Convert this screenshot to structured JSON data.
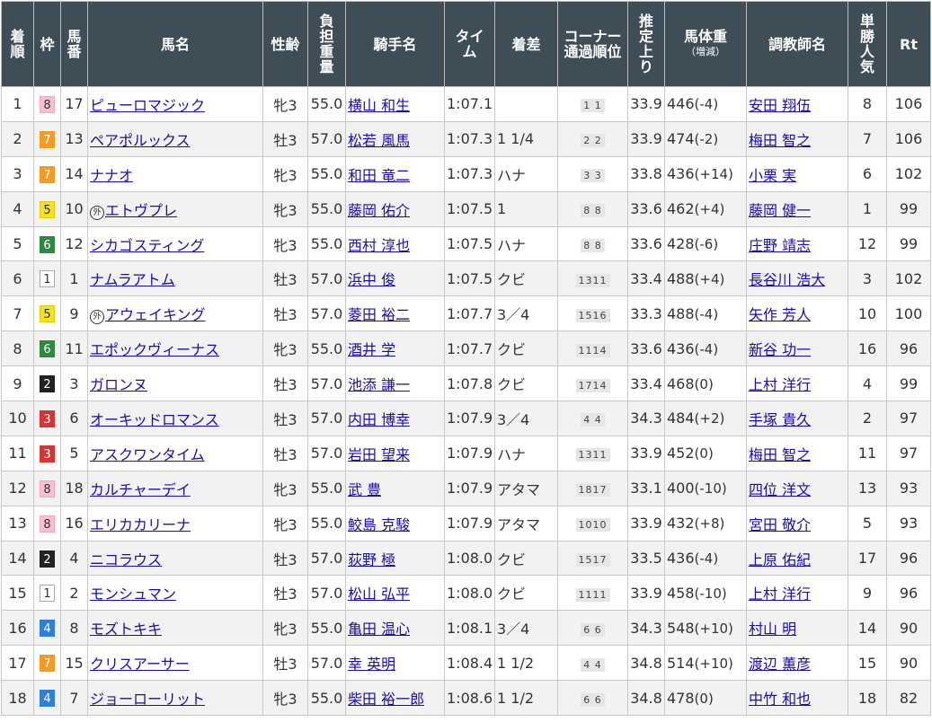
{
  "headers": {
    "rank": [
      "着",
      "順"
    ],
    "waku": [
      "枠"
    ],
    "umaban": [
      "馬",
      "番"
    ],
    "horse": "馬名",
    "sexage": "性齢",
    "weight": [
      "負",
      "担",
      "重",
      "量"
    ],
    "jockey": "騎手名",
    "time": [
      "タイ",
      "ム"
    ],
    "margin": "着差",
    "corner": [
      "コーナー",
      "通過順位"
    ],
    "last3f": [
      "推",
      "定",
      "上",
      "り"
    ],
    "body_weight": "馬体重",
    "body_weight_sub": "（増減）",
    "trainer": "調教師名",
    "popularity": [
      "単",
      "勝",
      "人",
      "気"
    ],
    "rating": "Rt"
  },
  "rows": [
    {
      "rank": "1",
      "waku": "8",
      "umaban": "17",
      "mark": "",
      "horse": "ピューロマジック",
      "sexage": "牝3",
      "weight": "55.0",
      "jockey": "横山 和生",
      "time": "1:07.1",
      "margin": "",
      "corner": "1 1",
      "last3f": "33.9",
      "bw": "446",
      "bwd": "(-4)",
      "trainer": "安田 翔伍",
      "pop": "8",
      "rt": "106"
    },
    {
      "rank": "2",
      "waku": "7",
      "umaban": "13",
      "mark": "",
      "horse": "ペアポルックス",
      "sexage": "牡3",
      "weight": "57.0",
      "jockey": "松若 風馬",
      "time": "1:07.3",
      "margin": "1 1/4",
      "corner": "2 2",
      "last3f": "33.9",
      "bw": "474",
      "bwd": "(-2)",
      "trainer": "梅田 智之",
      "pop": "7",
      "rt": "106"
    },
    {
      "rank": "3",
      "waku": "7",
      "umaban": "14",
      "mark": "",
      "horse": "ナナオ",
      "sexage": "牝3",
      "weight": "55.0",
      "jockey": "和田 竜二",
      "time": "1:07.3",
      "margin": "ハナ",
      "corner": "3 3",
      "last3f": "33.8",
      "bw": "436",
      "bwd": "(+14)",
      "trainer": "小栗 実",
      "pop": "6",
      "rt": "102"
    },
    {
      "rank": "4",
      "waku": "5",
      "umaban": "10",
      "mark": "外",
      "horse": "エトヴプレ",
      "sexage": "牝3",
      "weight": "55.0",
      "jockey": "藤岡 佑介",
      "time": "1:07.5",
      "margin": "1",
      "corner": "8 8",
      "last3f": "33.6",
      "bw": "462",
      "bwd": "(+4)",
      "trainer": "藤岡 健一",
      "pop": "1",
      "rt": "99"
    },
    {
      "rank": "5",
      "waku": "6",
      "umaban": "12",
      "mark": "",
      "horse": "シカゴスティング",
      "sexage": "牝3",
      "weight": "55.0",
      "jockey": "西村 淳也",
      "time": "1:07.5",
      "margin": "ハナ",
      "corner": "8 8",
      "last3f": "33.6",
      "bw": "428",
      "bwd": "(-6)",
      "trainer": "庄野 靖志",
      "pop": "12",
      "rt": "99"
    },
    {
      "rank": "6",
      "waku": "1",
      "umaban": "1",
      "mark": "",
      "horse": "ナムラアトム",
      "sexage": "牡3",
      "weight": "57.0",
      "jockey": "浜中 俊",
      "time": "1:07.5",
      "margin": "クビ",
      "corner": "1311",
      "last3f": "33.4",
      "bw": "488",
      "bwd": "(+4)",
      "trainer": "長谷川 浩大",
      "pop": "3",
      "rt": "102"
    },
    {
      "rank": "7",
      "waku": "5",
      "umaban": "9",
      "mark": "外",
      "horse": "アウェイキング",
      "sexage": "牡3",
      "weight": "57.0",
      "jockey": "菱田 裕二",
      "time": "1:07.7",
      "margin": "3／4",
      "corner": "1516",
      "last3f": "33.3",
      "bw": "488",
      "bwd": "(-4)",
      "trainer": "矢作 芳人",
      "pop": "10",
      "rt": "100"
    },
    {
      "rank": "8",
      "waku": "6",
      "umaban": "11",
      "mark": "",
      "horse": "エポックヴィーナス",
      "sexage": "牝3",
      "weight": "55.0",
      "jockey": "酒井 学",
      "time": "1:07.7",
      "margin": "クビ",
      "corner": "1114",
      "last3f": "33.6",
      "bw": "436",
      "bwd": "(-4)",
      "trainer": "新谷 功一",
      "pop": "16",
      "rt": "96"
    },
    {
      "rank": "9",
      "waku": "2",
      "umaban": "3",
      "mark": "",
      "horse": "ガロンヌ",
      "sexage": "牡3",
      "weight": "57.0",
      "jockey": "池添 謙一",
      "time": "1:07.8",
      "margin": "クビ",
      "corner": "1714",
      "last3f": "33.4",
      "bw": "468",
      "bwd": "(0)",
      "trainer": "上村 洋行",
      "pop": "4",
      "rt": "99"
    },
    {
      "rank": "10",
      "waku": "3",
      "umaban": "6",
      "mark": "",
      "horse": "オーキッドロマンス",
      "sexage": "牡3",
      "weight": "57.0",
      "jockey": "内田 博幸",
      "time": "1:07.9",
      "margin": "3／4",
      "corner": "4 4",
      "last3f": "34.3",
      "bw": "484",
      "bwd": "(+2)",
      "trainer": "手塚 貴久",
      "pop": "2",
      "rt": "97"
    },
    {
      "rank": "11",
      "waku": "3",
      "umaban": "5",
      "mark": "",
      "horse": "アスクワンタイム",
      "sexage": "牡3",
      "weight": "57.0",
      "jockey": "岩田 望来",
      "time": "1:07.9",
      "margin": "ハナ",
      "corner": "1311",
      "last3f": "33.9",
      "bw": "452",
      "bwd": "(0)",
      "trainer": "梅田 智之",
      "pop": "11",
      "rt": "97"
    },
    {
      "rank": "12",
      "waku": "8",
      "umaban": "18",
      "mark": "",
      "horse": "カルチャーデイ",
      "sexage": "牝3",
      "weight": "55.0",
      "jockey": "武 豊",
      "time": "1:07.9",
      "margin": "アタマ",
      "corner": "1817",
      "last3f": "33.1",
      "bw": "400",
      "bwd": "(-10)",
      "trainer": "四位 洋文",
      "pop": "13",
      "rt": "93"
    },
    {
      "rank": "13",
      "waku": "8",
      "umaban": "16",
      "mark": "",
      "horse": "エリカカリーナ",
      "sexage": "牝3",
      "weight": "55.0",
      "jockey": "鮫島 克駿",
      "time": "1:07.9",
      "margin": "アタマ",
      "corner": "1010",
      "last3f": "33.9",
      "bw": "432",
      "bwd": "(+8)",
      "trainer": "宮田 敬介",
      "pop": "5",
      "rt": "93"
    },
    {
      "rank": "14",
      "waku": "2",
      "umaban": "4",
      "mark": "",
      "horse": "ニコラウス",
      "sexage": "牡3",
      "weight": "57.0",
      "jockey": "荻野 極",
      "time": "1:08.0",
      "margin": "クビ",
      "corner": "1517",
      "last3f": "33.5",
      "bw": "436",
      "bwd": "(-4)",
      "trainer": "上原 佑紀",
      "pop": "17",
      "rt": "96"
    },
    {
      "rank": "15",
      "waku": "1",
      "umaban": "2",
      "mark": "",
      "horse": "モンシュマン",
      "sexage": "牡3",
      "weight": "57.0",
      "jockey": "松山 弘平",
      "time": "1:08.0",
      "margin": "クビ",
      "corner": "1111",
      "last3f": "33.9",
      "bw": "458",
      "bwd": "(-10)",
      "trainer": "上村 洋行",
      "pop": "9",
      "rt": "96"
    },
    {
      "rank": "16",
      "waku": "4",
      "umaban": "8",
      "mark": "",
      "horse": "モズトキキ",
      "sexage": "牝3",
      "weight": "55.0",
      "jockey": "亀田 温心",
      "time": "1:08.1",
      "margin": "3／4",
      "corner": "6 6",
      "last3f": "34.3",
      "bw": "548",
      "bwd": "(+10)",
      "trainer": "村山 明",
      "pop": "14",
      "rt": "90"
    },
    {
      "rank": "17",
      "waku": "7",
      "umaban": "15",
      "mark": "",
      "horse": "クリスアーサー",
      "sexage": "牡3",
      "weight": "57.0",
      "jockey": "幸 英明",
      "time": "1:08.4",
      "margin": "1 1/2",
      "corner": "4 4",
      "last3f": "34.8",
      "bw": "514",
      "bwd": "(+10)",
      "trainer": "渡辺 薫彦",
      "pop": "15",
      "rt": "90"
    },
    {
      "rank": "18",
      "waku": "4",
      "umaban": "7",
      "mark": "",
      "horse": "ジョーローリット",
      "sexage": "牝3",
      "weight": "55.0",
      "jockey": "柴田 裕一郎",
      "time": "1:08.6",
      "margin": "1 1/2",
      "corner": "6 6",
      "last3f": "34.8",
      "bw": "478",
      "bwd": "(0)",
      "trainer": "中竹 和也",
      "pop": "18",
      "rt": "82"
    }
  ]
}
